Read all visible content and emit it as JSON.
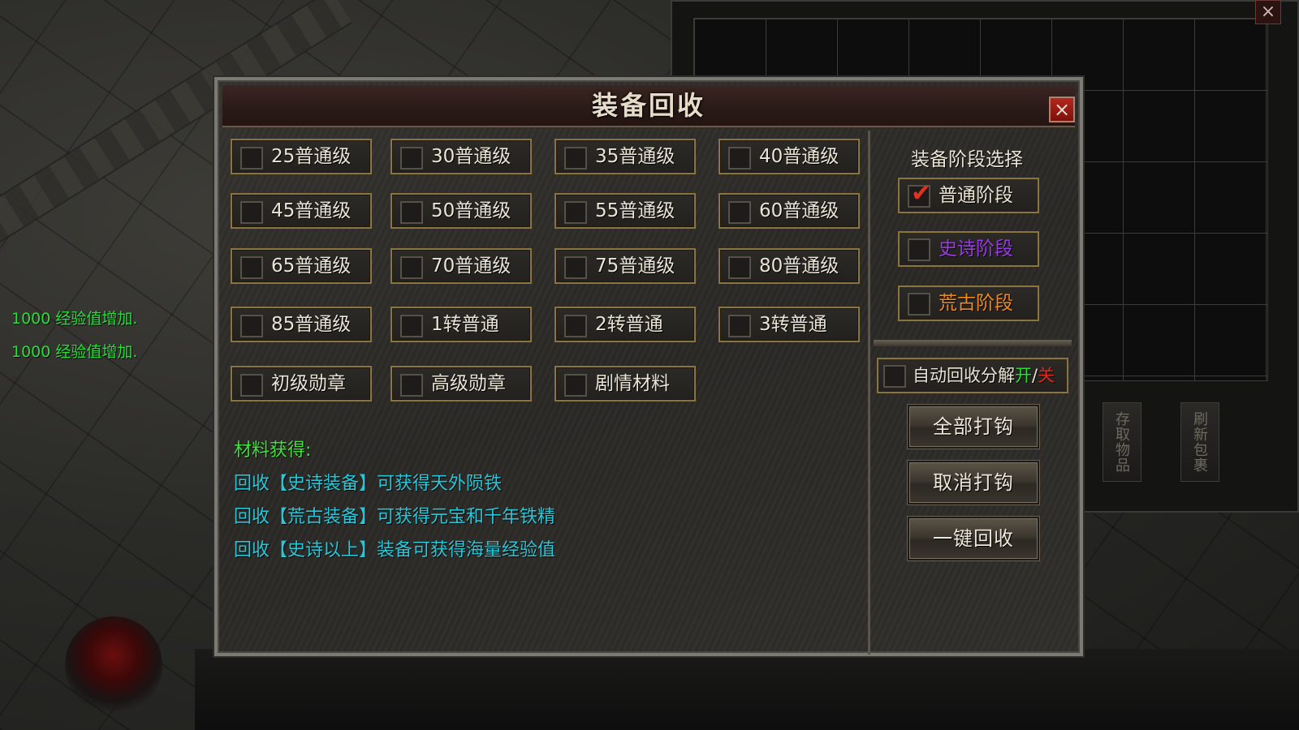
{
  "background": {
    "exp_messages": [
      "1000 经验值增加.",
      "1000 经验值增加."
    ]
  },
  "inventory": {
    "close_icon": "×",
    "side_buttons": [
      "存取物品",
      "刷新包裹"
    ]
  },
  "dialog": {
    "title": "装备回收",
    "close_icon": "×",
    "options": [
      {
        "label": "25普通级",
        "checked": false
      },
      {
        "label": "30普通级",
        "checked": false
      },
      {
        "label": "35普通级",
        "checked": false
      },
      {
        "label": "40普通级",
        "checked": false
      },
      {
        "label": "45普通级",
        "checked": false
      },
      {
        "label": "50普通级",
        "checked": false
      },
      {
        "label": "55普通级",
        "checked": false
      },
      {
        "label": "60普通级",
        "checked": false
      },
      {
        "label": "65普通级",
        "checked": false
      },
      {
        "label": "70普通级",
        "checked": false
      },
      {
        "label": "75普通级",
        "checked": false
      },
      {
        "label": "80普通级",
        "checked": false
      },
      {
        "label": "85普通级",
        "checked": false
      },
      {
        "label": "1转普通",
        "checked": false
      },
      {
        "label": "2转普通",
        "checked": false
      },
      {
        "label": "3转普通",
        "checked": false
      },
      {
        "label": "初级勋章",
        "checked": false
      },
      {
        "label": "高级勋章",
        "checked": false
      },
      {
        "label": "剧情材料",
        "checked": false
      }
    ],
    "info": {
      "heading": "材料获得:",
      "lines": [
        "回收【史诗装备】可获得天外陨铁",
        "回收【荒古装备】可获得元宝和千年铁精",
        "回收【史诗以上】装备可获得海量经验值"
      ]
    },
    "stage_panel": {
      "title": "装备阶段选择",
      "stages": [
        {
          "label": "普通阶段",
          "checked": true,
          "color": "#eae4d6"
        },
        {
          "label": "史诗阶段",
          "checked": false,
          "color": "#9b38e8"
        },
        {
          "label": "荒古阶段",
          "checked": false,
          "color": "#f08a1e"
        }
      ],
      "check_icon": "✔",
      "auto_recycle": {
        "label": "自动回收分解",
        "on": "开",
        "separator": "/",
        "off": "关",
        "checked": false
      },
      "buttons": {
        "check_all": "全部打钩",
        "uncheck_all": "取消打钩",
        "one_click_recycle": "一键回收"
      }
    }
  }
}
